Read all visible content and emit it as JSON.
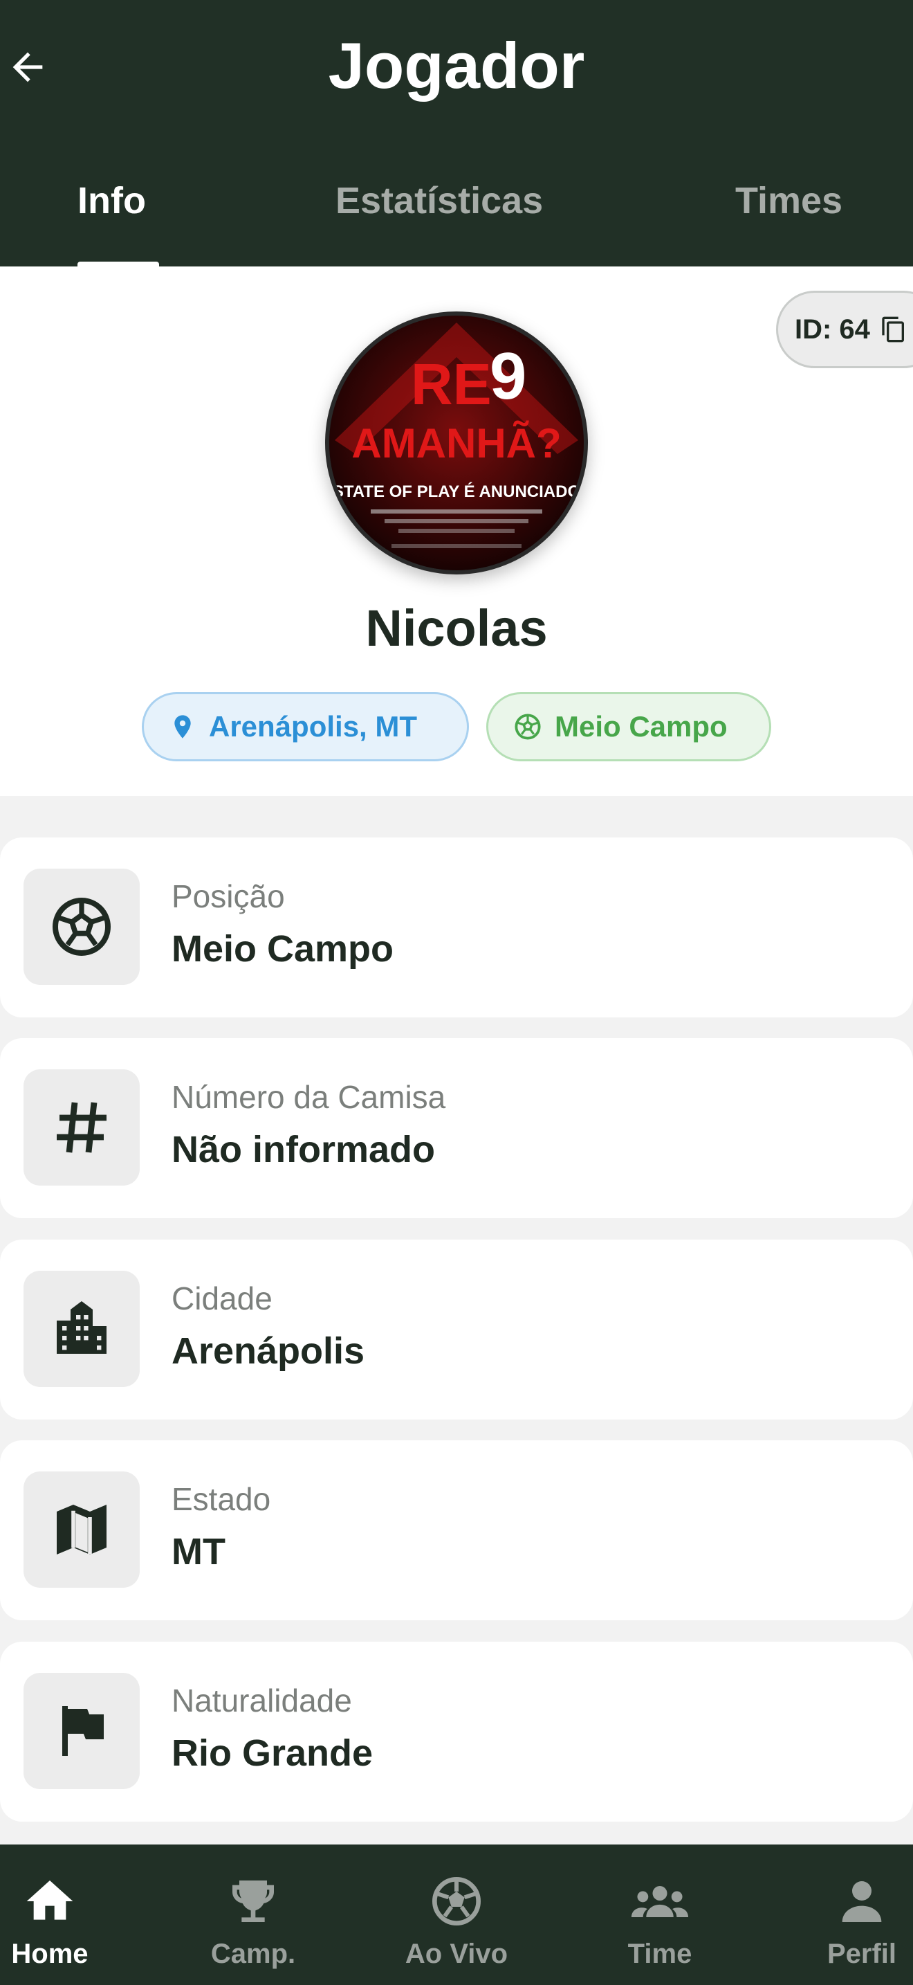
{
  "header": {
    "title": "Jogador",
    "tabs": [
      {
        "label": "Info",
        "active": true
      },
      {
        "label": "Estatísticas",
        "active": false
      },
      {
        "label": "Times",
        "active": false
      }
    ]
  },
  "profile": {
    "id_label": "ID: 64",
    "avatar_text": {
      "headline_red": "RE",
      "headline_accent": "9",
      "headline2": "AMANHÃ?",
      "subline": "STATE OF PLAY É ANUNCIADO"
    },
    "name": "Nicolas",
    "location_chip": "Arenápolis, MT",
    "position_chip": "Meio Campo"
  },
  "info_rows": [
    {
      "label": "Posição",
      "value": "Meio Campo",
      "icon": "soccer-ball-icon"
    },
    {
      "label": "Número da Camisa",
      "value": "Não informado",
      "icon": "hash-icon"
    },
    {
      "label": "Cidade",
      "value": "Arenápolis",
      "icon": "city-icon"
    },
    {
      "label": "Estado",
      "value": "MT",
      "icon": "map-icon"
    },
    {
      "label": "Naturalidade",
      "value": "Rio Grande",
      "icon": "flag-icon"
    }
  ],
  "bottom_nav": [
    {
      "label": "Home",
      "icon": "home-icon",
      "active": true
    },
    {
      "label": "Camp.",
      "icon": "trophy-icon",
      "active": false
    },
    {
      "label": "Ao Vivo",
      "icon": "soccer-ball-icon",
      "active": false
    },
    {
      "label": "Time",
      "icon": "group-icon",
      "active": false
    },
    {
      "label": "Perfil",
      "icon": "person-icon",
      "active": false
    }
  ],
  "colors": {
    "header_bg": "#213026",
    "location_accent": "#2b8fd6",
    "position_accent": "#47a64a"
  }
}
